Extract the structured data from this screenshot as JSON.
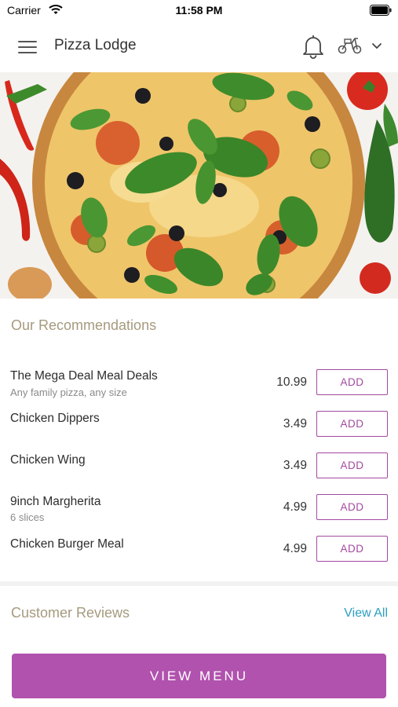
{
  "status_bar": {
    "carrier": "Carrier",
    "time": "11:58 PM"
  },
  "header": {
    "title": "Pizza Lodge",
    "icons": [
      "menu-icon",
      "bell-icon",
      "scooter-icon",
      "chevron-down-icon"
    ]
  },
  "hero": {
    "description_icon": "pizza-image"
  },
  "recommendations": {
    "title": "Our Recommendations",
    "items": [
      {
        "name": "The Mega Deal Meal Deals",
        "description": "Any family pizza, any size",
        "price": "10.99",
        "button": "ADD"
      },
      {
        "name": "Chicken Dippers",
        "description": "",
        "price": "3.49",
        "button": "ADD"
      },
      {
        "name": "Chicken Wing",
        "description": "",
        "price": "3.49",
        "button": "ADD"
      },
      {
        "name": "9inch Margherita",
        "description": "6 slices",
        "price": "4.99",
        "button": "ADD"
      },
      {
        "name": "Chicken Burger Meal",
        "description": "",
        "price": "4.99",
        "button": "ADD"
      }
    ]
  },
  "reviews": {
    "title": "Customer Reviews",
    "view_all": "View All"
  },
  "footer": {
    "view_menu": "VIEW MENU"
  },
  "colors": {
    "accent": "#b052ae",
    "button_outline": "#a3499f",
    "section_title": "#a69a7e",
    "link": "#2a9fc2"
  }
}
